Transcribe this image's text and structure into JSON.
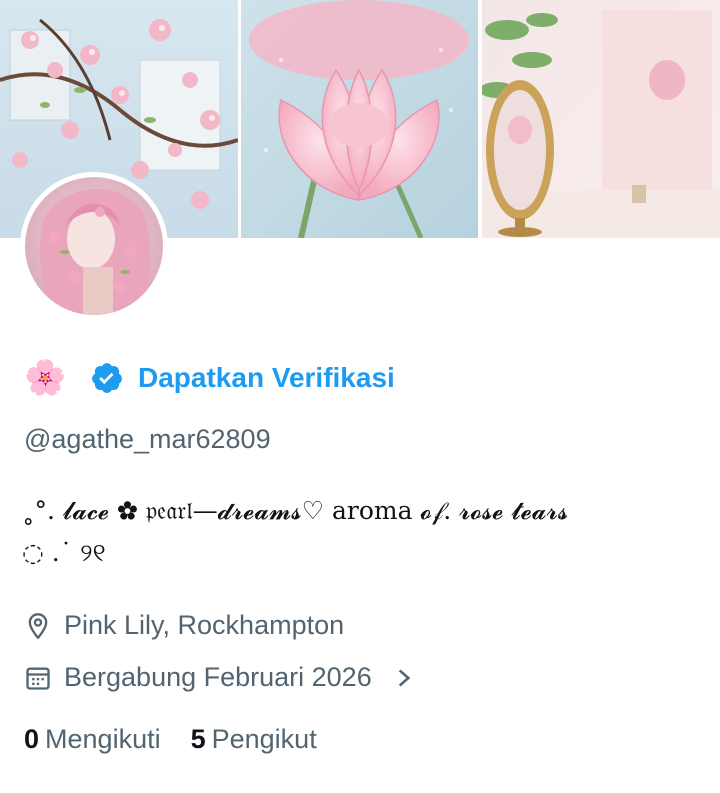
{
  "profile": {
    "emoji": "🌸",
    "verify_link": "Dapatkan Verifikasi",
    "handle": "@agathe_mar62809",
    "bio_line1": "˳°. 𝓵𝓪𝓬𝓮  ✿ 𝔭𝔢𝔞𝔯𝔩—𝓭𝓻𝓮𝓪𝓶𝓼♡ aroma 𝓸𝒻. 𝓻𝓸𝓼𝓮 𝓽𝓮𝓪𝓻𝓼",
    "bio_line2": "◌ .˙  ୨୧",
    "location": "Pink Lily, Rockhampton",
    "joined": "Bergabung Februari 2026",
    "following_count": "0",
    "following_label": "Mengikuti",
    "followers_count": "5",
    "followers_label": "Pengikut"
  },
  "icons": {
    "verify": "verified-badge-icon",
    "location": "location-pin-icon",
    "calendar": "calendar-icon",
    "chevron": "chevron-right-icon"
  },
  "colors": {
    "accent": "#1d9bf0",
    "secondary_text": "#536471",
    "primary_text": "#0f1419"
  }
}
